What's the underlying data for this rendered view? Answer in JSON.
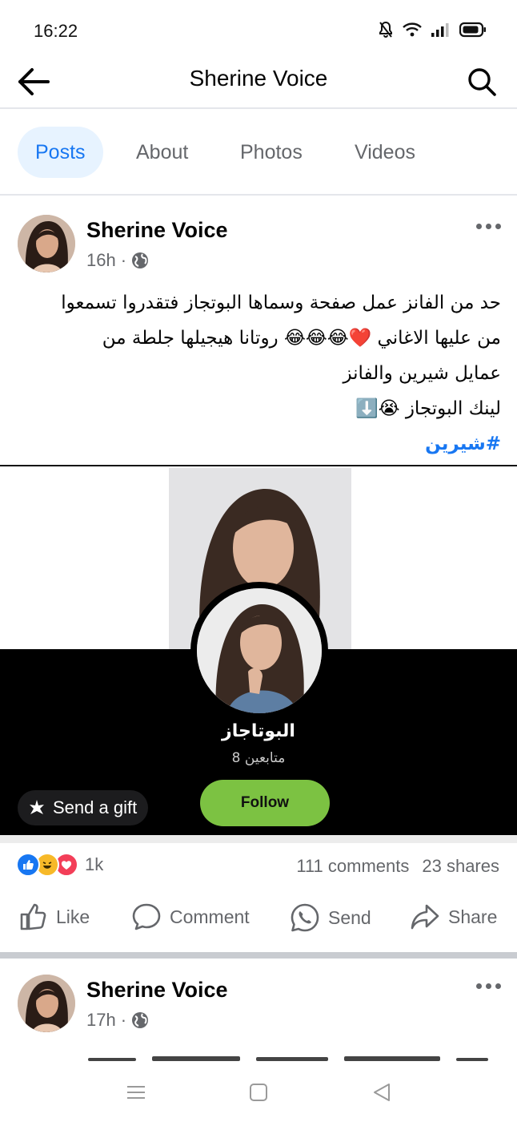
{
  "status_bar": {
    "time": "16:22"
  },
  "header": {
    "title": "Sherine Voice"
  },
  "tabs": [
    {
      "label": "Posts",
      "active": true
    },
    {
      "label": "About",
      "active": false
    },
    {
      "label": "Photos",
      "active": false
    },
    {
      "label": "Videos",
      "active": false
    }
  ],
  "post": {
    "author": "Sherine Voice",
    "time": "16h",
    "visibility_icon": "globe-icon",
    "lines": [
      "حد من الفانز عمل صفحة وسماها البوتجاز فتقدروا تسمعوا",
      "من عليها الاغاني ❤️😂😂😂 روتانا هيجيلها جلطة من",
      "عمايل شيرين والفانز",
      "لينك البوتجاز 😭⬇️"
    ],
    "hashtag": "#شيرين",
    "media": {
      "name": "البوتاجاز",
      "followers": "متابعين 8",
      "follow_label": "Follow",
      "gift_label": "Send a gift"
    },
    "reactions": [
      "like",
      "haha",
      "love"
    ],
    "reaction_count": "1k",
    "comments": "111 comments",
    "shares": "23 shares",
    "actions": {
      "like": "Like",
      "comment": "Comment",
      "send": "Send",
      "share": "Share"
    }
  },
  "next_post": {
    "author": "Sherine Voice",
    "time": "17h"
  },
  "colors": {
    "accent": "#1877f2",
    "tab_active_bg": "#e7f3ff",
    "secondary_text": "#65676b",
    "follow_green": "#7cc242"
  }
}
